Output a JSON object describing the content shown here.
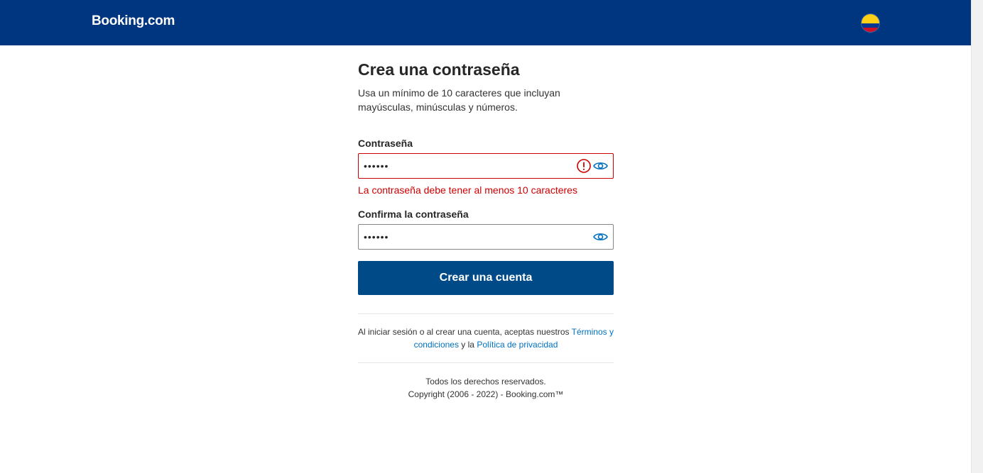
{
  "header": {
    "logo": "Booking.com",
    "flag_colors": [
      "#fcd116",
      "#003893",
      "#ce1126"
    ],
    "flag_icon": "colombia-flag-icon"
  },
  "form": {
    "title": "Crea una contraseña",
    "subtitle": "Usa un mínimo de 10 caracteres que incluyan mayúsculas, minúsculas y números.",
    "password": {
      "label": "Contraseña",
      "value": "••••••",
      "error": "La contraseña debe tener al menos 10 caracteres",
      "error_icon": "exclamation-circle-icon",
      "toggle_icon": "eye-icon"
    },
    "confirm": {
      "label": "Confirma la contraseña",
      "value": "••••••",
      "toggle_icon": "eye-icon"
    },
    "submit_label": "Crear una cuenta"
  },
  "legal": {
    "prefix": "Al iniciar sesión o al crear una cuenta, aceptas nuestros ",
    "terms_link": "Términos y condiciones",
    "middle": " y la ",
    "privacy_link": "Política de privacidad"
  },
  "footer": {
    "rights": "Todos los derechos reservados.",
    "copyright": "Copyright (2006 - 2022) - Booking.com™"
  },
  "colors": {
    "header_bg": "#003580",
    "button_bg": "#004b87",
    "error": "#cc0000",
    "link": "#0071c2"
  }
}
